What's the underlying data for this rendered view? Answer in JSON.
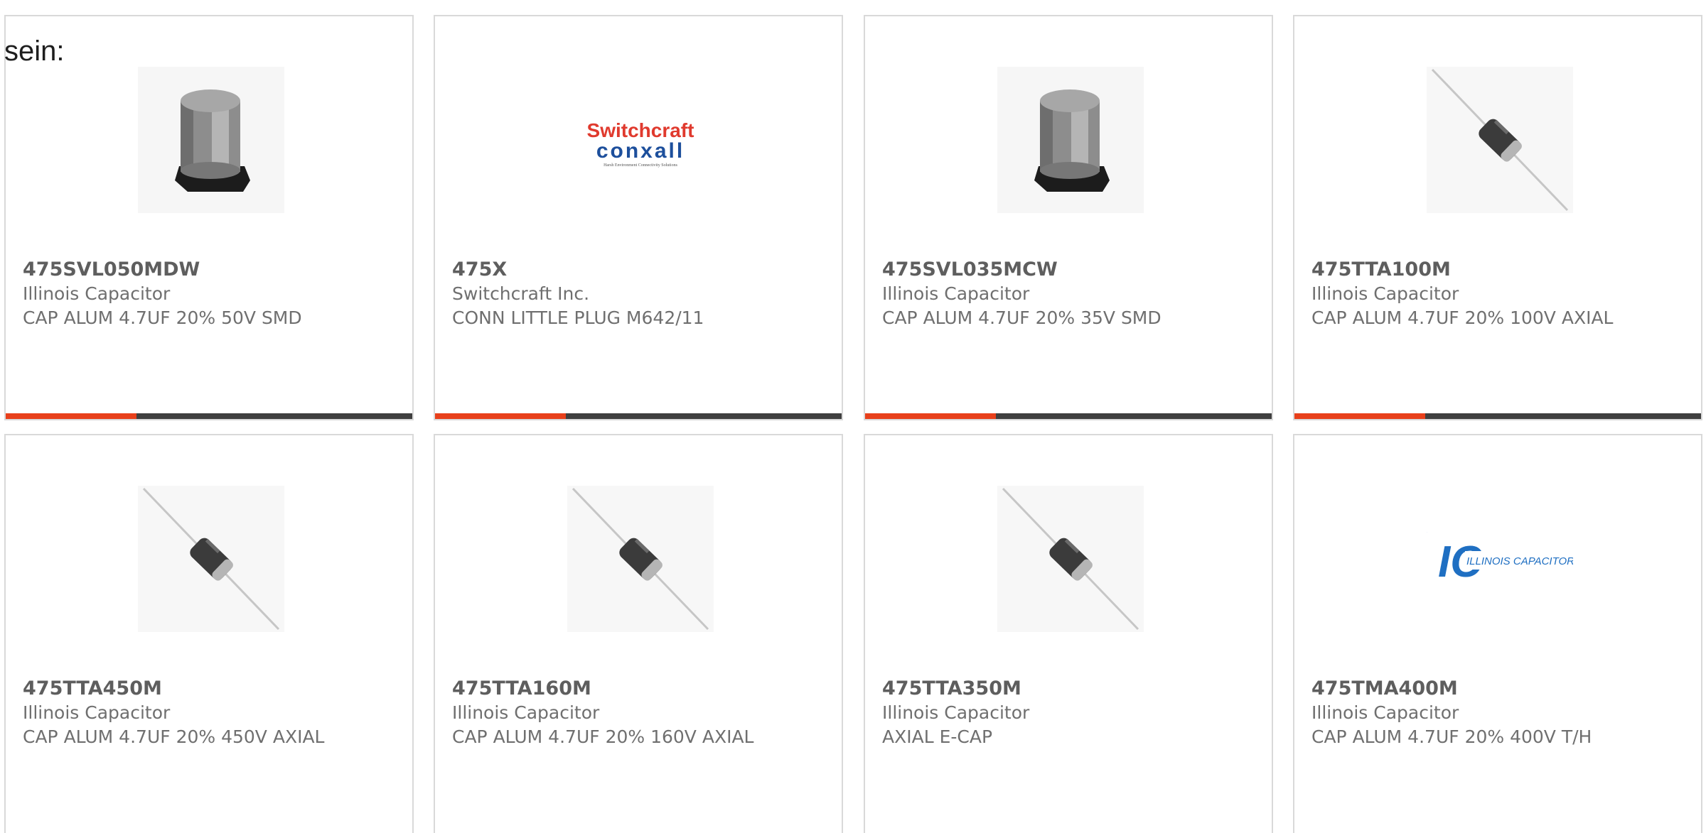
{
  "intro_text": "sein:",
  "products": [
    {
      "part": "475SVL050MDW",
      "maker": "Illinois Capacitor",
      "desc": "CAP ALUM 4.7UF 20% 50V SMD",
      "image": "smd-capacitor-image"
    },
    {
      "part": "475X",
      "maker": "Switchcraft Inc.",
      "desc": "CONN LITTLE PLUG M642/11",
      "image": "switchcraft-conxall-logo"
    },
    {
      "part": "475SVL035MCW",
      "maker": "Illinois Capacitor",
      "desc": "CAP ALUM 4.7UF 20% 35V SMD",
      "image": "smd-capacitor-image"
    },
    {
      "part": "475TTA100M",
      "maker": "Illinois Capacitor",
      "desc": "CAP ALUM 4.7UF 20% 100V AXIAL",
      "image": "axial-capacitor-image"
    },
    {
      "part": "475TTA450M",
      "maker": "Illinois Capacitor",
      "desc": "CAP ALUM 4.7UF 20% 450V AXIAL",
      "image": "axial-capacitor-image"
    },
    {
      "part": "475TTA160M",
      "maker": "Illinois Capacitor",
      "desc": "CAP ALUM 4.7UF 20% 160V AXIAL",
      "image": "axial-capacitor-image"
    },
    {
      "part": "475TTA350M",
      "maker": "Illinois Capacitor",
      "desc": "AXIAL E-CAP",
      "image": "axial-capacitor-image"
    },
    {
      "part": "475TMA400M",
      "maker": "Illinois Capacitor",
      "desc": "CAP ALUM 4.7UF 20% 400V T/H",
      "image": "illinois-capacitor-logo"
    }
  ],
  "logos": {
    "switchcraft_top": "Switchcraft",
    "switchcraft_bottom": "conxall",
    "switchcraft_tagline": "Harsh Environment Connectivity Solutions",
    "ic_mark": "IC",
    "ic_text": "ILLINOIS CAPACITOR, INC."
  },
  "colors": {
    "accent_bar": "#e8401b",
    "dark_bar": "#3f3f3f",
    "text_gray": "#6f6f6f",
    "switchcraft_red": "#e03a2e",
    "conxall_blue": "#1d4f9c",
    "ic_blue": "#1f6fc2"
  }
}
